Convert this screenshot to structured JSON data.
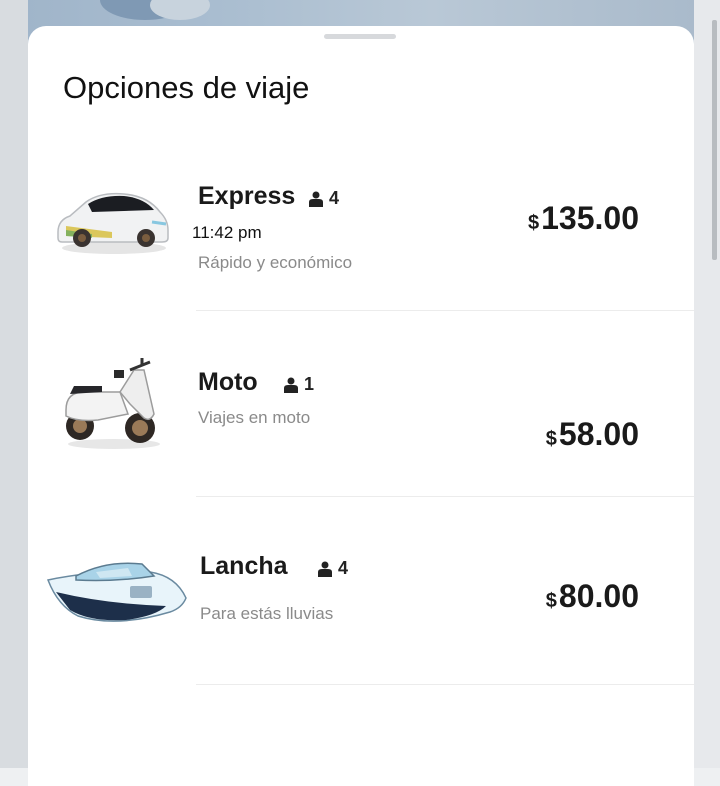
{
  "sheet": {
    "title": "Opciones de viaje"
  },
  "options": [
    {
      "name": "Express",
      "passengers": "4",
      "eta": "11:42 pm",
      "description": "Rápido y económico",
      "currency": "$",
      "price": "135.00",
      "vehicle_icon": "car-icon"
    },
    {
      "name": "Moto",
      "passengers": "1",
      "description": "Viajes en moto",
      "currency": "$",
      "price": "58.00",
      "vehicle_icon": "motorcycle-icon"
    },
    {
      "name": "Lancha",
      "passengers": "4",
      "description": "Para estás lluvias",
      "currency": "$",
      "price": "80.00",
      "vehicle_icon": "boat-icon"
    }
  ],
  "colors": {
    "sheet_bg": "#ffffff",
    "text_primary": "#1a1a1a",
    "text_secondary": "#8a8a8a",
    "divider": "#ececec"
  }
}
